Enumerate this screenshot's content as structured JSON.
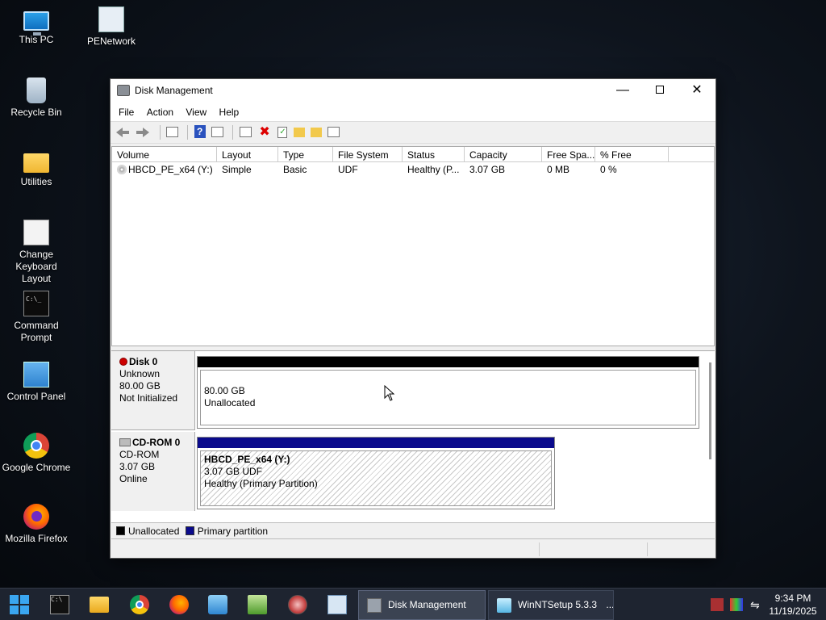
{
  "desktop": {
    "icons": [
      {
        "label": "This PC"
      },
      {
        "label": "PENetwork"
      },
      {
        "label": "Recycle Bin"
      },
      {
        "label": "Utilities"
      },
      {
        "label": "Change Keyboard Layout"
      },
      {
        "label": "Command Prompt"
      },
      {
        "label": "Control Panel"
      },
      {
        "label": "Google Chrome"
      },
      {
        "label": "Mozilla Firefox"
      }
    ],
    "cmd_icon_text": "C:\\_"
  },
  "window": {
    "title": "Disk Management",
    "controls": {
      "minimize": "—",
      "close": "✕"
    },
    "menu": [
      "File",
      "Action",
      "View",
      "Help"
    ],
    "toolbar": {
      "help_glyph": "?",
      "delete_glyph": "✖",
      "check_glyph": "✓"
    },
    "volume_list": {
      "columns": [
        "Volume",
        "Layout",
        "Type",
        "File System",
        "Status",
        "Capacity",
        "Free Spa...",
        "% Free"
      ],
      "rows": [
        {
          "volume": "HBCD_PE_x64 (Y:)",
          "layout": "Simple",
          "type": "Basic",
          "file_system": "UDF",
          "status": "Healthy (P...",
          "capacity": "3.07 GB",
          "free_space": "0 MB",
          "percent_free": "0 %"
        }
      ]
    },
    "disks": [
      {
        "name": "Disk 0",
        "type": "Unknown",
        "size": "80.00 GB",
        "state": "Not Initialized",
        "partition": {
          "size": "80.00 GB",
          "label": "Unallocated"
        }
      },
      {
        "name": "CD-ROM 0",
        "type": "CD-ROM",
        "size": "3.07 GB",
        "state": "Online",
        "partition": {
          "name": "HBCD_PE_x64  (Y:)",
          "size_fs": "3.07 GB UDF",
          "status": "Healthy (Primary Partition)"
        }
      }
    ],
    "legend": [
      "Unallocated",
      "Primary partition"
    ]
  },
  "taskbar": {
    "cmd_text": "C:\\",
    "buttons": [
      {
        "label": "Disk Management"
      },
      {
        "label": "WinNTSetup 5.3.3"
      }
    ],
    "overflow": "...",
    "tray_glyph": "⇋",
    "clock": {
      "time": "9:34 PM",
      "date": "11/19/2025"
    }
  },
  "colors": {
    "unallocated": "#000000",
    "primary_partition": "#0a0a8c",
    "taskbar": "#1e2430"
  }
}
